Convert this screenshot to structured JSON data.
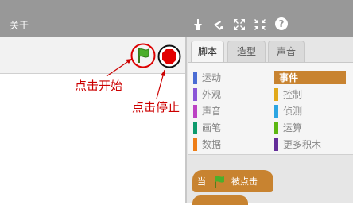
{
  "menu": {
    "about_label": "关于"
  },
  "toolbar_icons": [
    "duplicate-icon",
    "cut-icon",
    "grow-icon",
    "shrink-icon",
    "help-icon"
  ],
  "annotations": {
    "start": "点击开始",
    "stop": "点击停止"
  },
  "tabs": [
    {
      "label": "脚本"
    },
    {
      "label": "造型"
    },
    {
      "label": "声音"
    }
  ],
  "categories": {
    "left": [
      {
        "label": "运动",
        "color": "#4a6cd4"
      },
      {
        "label": "外观",
        "color": "#8a55d7"
      },
      {
        "label": "声音",
        "color": "#bb42c3"
      },
      {
        "label": "画笔",
        "color": "#0e9a6c"
      },
      {
        "label": "数据",
        "color": "#ee7d16"
      }
    ],
    "right": [
      {
        "label": "事件",
        "color": "#c88330"
      },
      {
        "label": "控制",
        "color": "#e1a91a"
      },
      {
        "label": "侦测",
        "color": "#2ca5e2"
      },
      {
        "label": "运算",
        "color": "#5cb712"
      },
      {
        "label": "更多积木",
        "color": "#632d99"
      }
    ]
  },
  "block": {
    "when": "当",
    "clicked": "被点击"
  },
  "colors": {
    "accent": "#c88330",
    "annotation": "#cc0000"
  }
}
